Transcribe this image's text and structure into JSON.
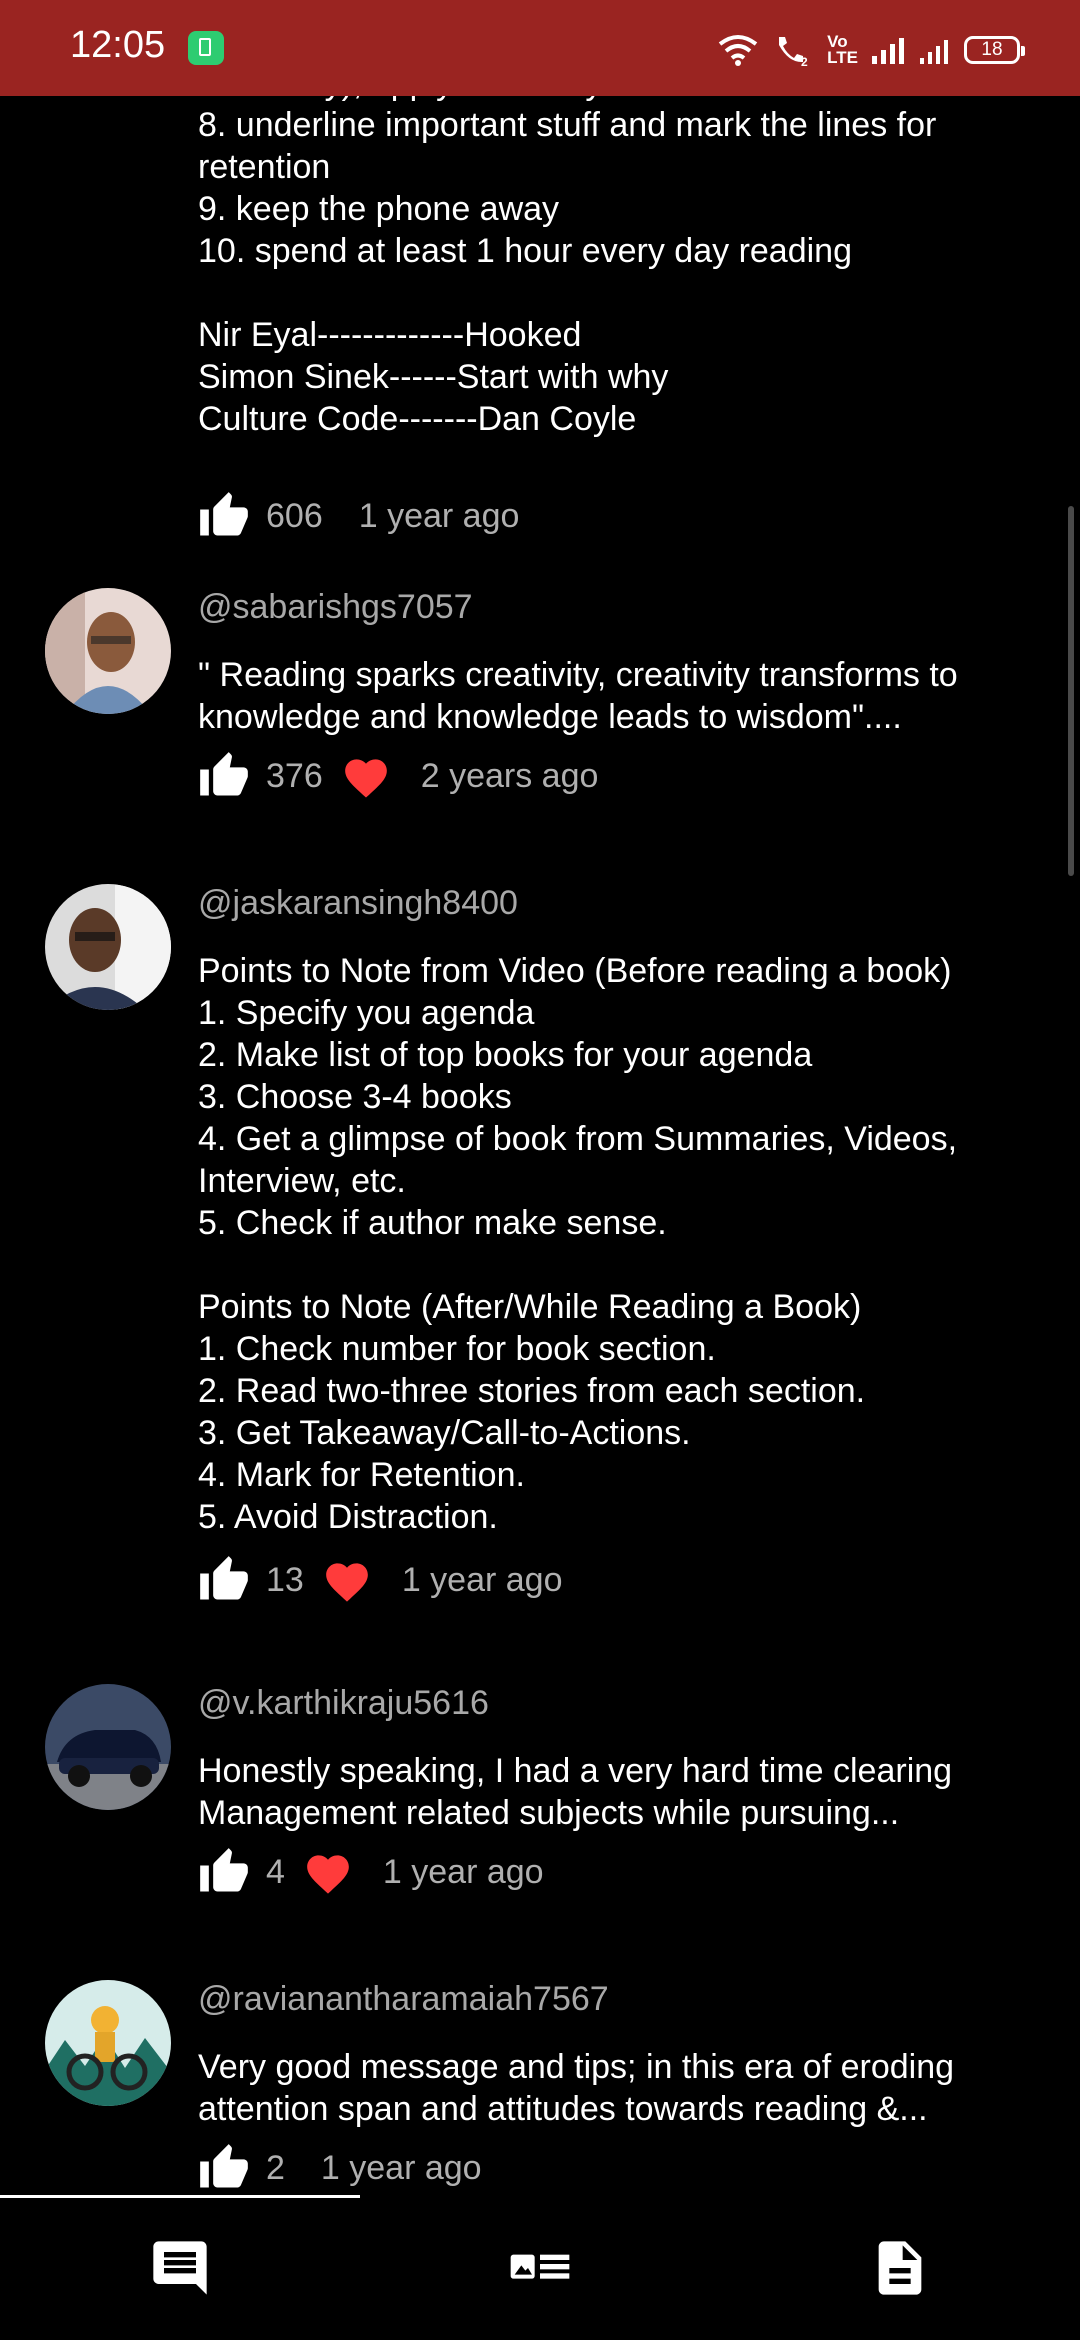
{
  "status_bar": {
    "time": "12:05",
    "volte": "Vo\nLTE",
    "battery": "18",
    "bar_color": "#9a2421"
  },
  "comment0": {
    "lines": [
      "takeaway), apply them to your life",
      "8. underline important stuff and mark the lines for",
      "retention",
      "9. keep the phone away",
      "10. spend at least 1 hour every day reading",
      "",
      "Nir Eyal-------------Hooked",
      "Simon Sinek------Start with why",
      "Culture Code-------Dan Coyle"
    ],
    "likes": "606",
    "time": "1 year ago"
  },
  "comment1": {
    "handle": "@sabarishgs7057",
    "lines": [
      "\" Reading sparks creativity, creativity transforms to",
      "knowledge and knowledge leads to wisdom\"...."
    ],
    "likes": "376",
    "hearted": true,
    "time": "2 years ago"
  },
  "comment2": {
    "handle": "@jaskaransingh8400",
    "lines": [
      "Points to Note from Video (Before reading a book)",
      "1. Specify you agenda",
      "2. Make list of top books for your agenda",
      "3. Choose 3-4 books",
      "4. Get a glimpse of book from Summaries, Videos,",
      "Interview, etc.",
      "5. Check if author make sense.",
      "",
      "Points to Note (After/While Reading a Book)",
      "1. Check number for book section.",
      "2. Read two-three stories from each section.",
      "3. Get Takeaway/Call-to-Actions.",
      "4. Mark for Retention.",
      "5. Avoid Distraction."
    ],
    "likes": "13",
    "hearted": true,
    "time": "1 year ago"
  },
  "comment3": {
    "handle": "@v.karthikraju5616",
    "lines": [
      "Honestly speaking, I had a very hard time clearing",
      "Management related subjects while pursuing..."
    ],
    "likes": "4",
    "hearted": true,
    "time": "1 year ago"
  },
  "comment4": {
    "handle": "@ravianantharamaiah7567",
    "lines": [
      "Very good message and tips; in this era of eroding",
      "attention span and attitudes towards reading &..."
    ],
    "likes": "2",
    "time": "1 year ago"
  },
  "bottom_nav": {
    "items": [
      "comments-icon",
      "description-icon",
      "document-icon"
    ]
  },
  "colors": {
    "heart": "#ff3b3b",
    "secondary_text": "#b0b0b0"
  }
}
